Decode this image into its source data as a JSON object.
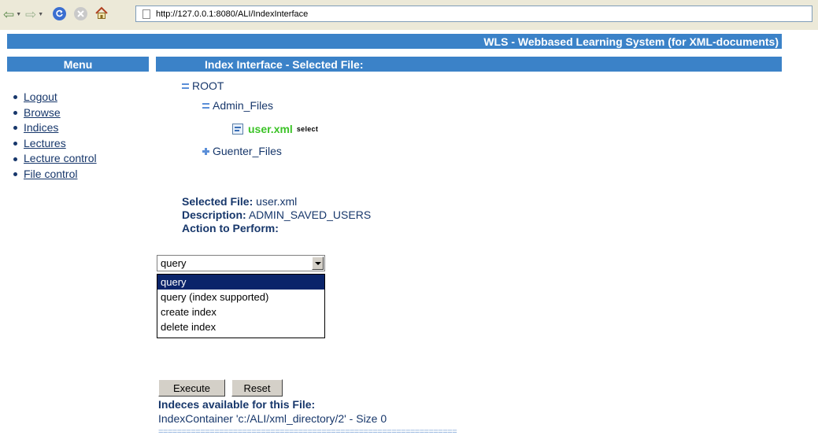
{
  "browser": {
    "url": "http://127.0.0.1:8080/ALI/IndexInterface",
    "icons": [
      "back-arrow-icon",
      "forward-arrow-icon",
      "refresh-icon",
      "stop-icon",
      "home-icon",
      "page-icon"
    ]
  },
  "banner": {
    "title": "WLS - Webbased Learning System (for XML-documents)"
  },
  "menu": {
    "header": "Menu",
    "items": [
      {
        "label": "Logout"
      },
      {
        "label": "Browse"
      },
      {
        "label": "Indices"
      },
      {
        "label": "Lectures"
      },
      {
        "label": "Lecture control"
      },
      {
        "label": "File control"
      }
    ]
  },
  "content": {
    "header": "Index Interface - Selected File:",
    "tree": {
      "root": "ROOT",
      "admin_folder": "Admin_Files",
      "file": {
        "name": "user.xml",
        "action": "select"
      },
      "guenter_folder": "Guenter_Files"
    },
    "info": {
      "selected_label": "Selected File:",
      "selected_value": "user.xml",
      "description_label": "Description:",
      "description_value": "ADMIN_SAVED_USERS",
      "action_label": "Action to Perform:"
    },
    "action_select": {
      "value": "query",
      "options": [
        "query",
        "query (index supported)",
        "create index",
        "delete index"
      ],
      "highlighted_index": 0
    },
    "buttons": {
      "execute": "Execute",
      "reset": "Reset"
    },
    "indices": {
      "heading": "Indeces available for this File:",
      "entry": "IndexContainer 'c:/ALI/xml_directory/2' - Size 0",
      "separator": "================================================================"
    }
  },
  "colors": {
    "header_bar": "#3b82c8",
    "text": "#17376b",
    "file_highlight": "#3cc328",
    "option_selected": "#0a246a"
  }
}
